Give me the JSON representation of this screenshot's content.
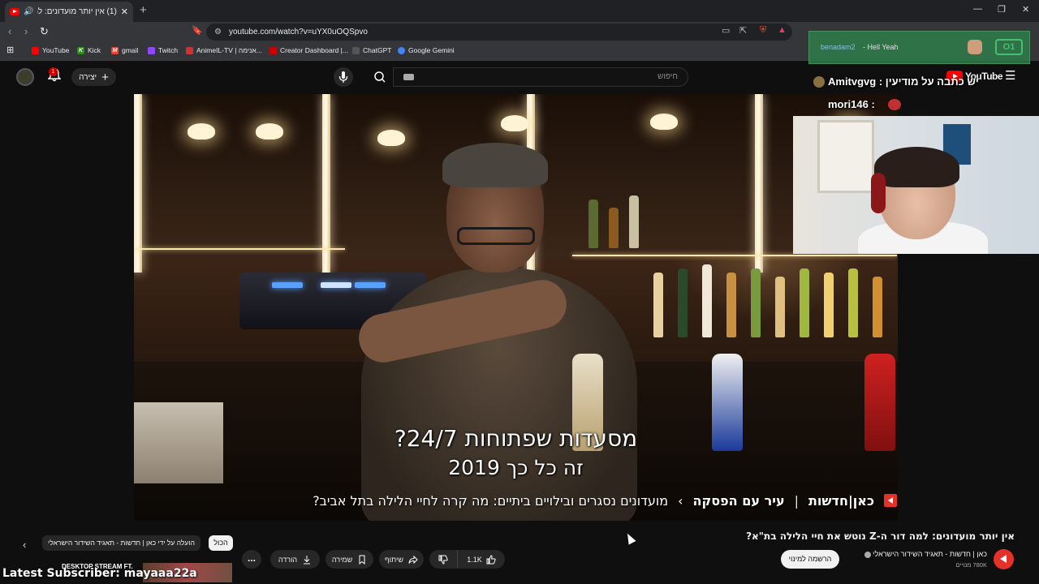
{
  "browser": {
    "tab_title": "(1) אין יותר מועדונים: למה דור",
    "tab_close": "✕",
    "new_tab": "+",
    "url": "youtube.com/watch?v=uYX0uOQSpvo",
    "bookmarks": [
      {
        "label": "YouTube",
        "color": "#ff0000"
      },
      {
        "label": "Kick",
        "color": "#53fc18"
      },
      {
        "label": "gmail",
        "color": "#ea4335"
      },
      {
        "label": "Twitch",
        "color": "#9146ff"
      },
      {
        "label": "AnimeIL-TV | אנימה...",
        "color": "#c33"
      },
      {
        "label": "Creator Dashboard |...",
        "color": "#cc0000"
      },
      {
        "label": "ChatGPT",
        "color": "#555"
      },
      {
        "label": "Google Gemini",
        "color": "#4285f4"
      }
    ]
  },
  "masthead": {
    "notification_count": "1",
    "create_label": "יצירה",
    "search_placeholder": "חיפוש",
    "logo_text": "YouTube"
  },
  "video": {
    "subtitle_line1": "מסעדות שפתוחות 24/7?",
    "subtitle_line2": "זה כל כך 2019",
    "ticker_brand": "כאן|חדשות",
    "ticker_sep": "|",
    "ticker_section": "עיר עם הפסקה",
    "ticker_arrow": "›",
    "ticker_headline": "מועדונים נסגרים ובילויים ביתיים: מה קרה לחיי הלילה בתל אביב?"
  },
  "overlay": {
    "alert_user": "benadam2",
    "alert_message": "- Hell Yeah",
    "alert_count": "O1",
    "chat": [
      {
        "text": "יש כתבה על מודיעין : Amitvgvg"
      },
      {
        "text": "mori146 :"
      }
    ],
    "latest_subscriber": "Latest Subscriber: mayaaa22a",
    "desktop_stream": "DESKTOP STREAM FT."
  },
  "watch": {
    "title": "אין יותר מועדונים: למה דור ה-Z נוטש את חיי הלילה בת\"א?",
    "channel_name": "כאן | חדשות - תאגיד השידור הישראלי",
    "subscribers": "780K מנויים",
    "subscribed_label": "הרשמה למינוי",
    "like_count": "1.1K",
    "share_label": "שיתוף",
    "save_label": "שמירה",
    "download_label": "הורדה",
    "more_label": "...",
    "chip_all": "הכול",
    "chip_uploaded": "הועלה על ידי כאן | חדשות - תאגיד השידור הישראלי"
  }
}
